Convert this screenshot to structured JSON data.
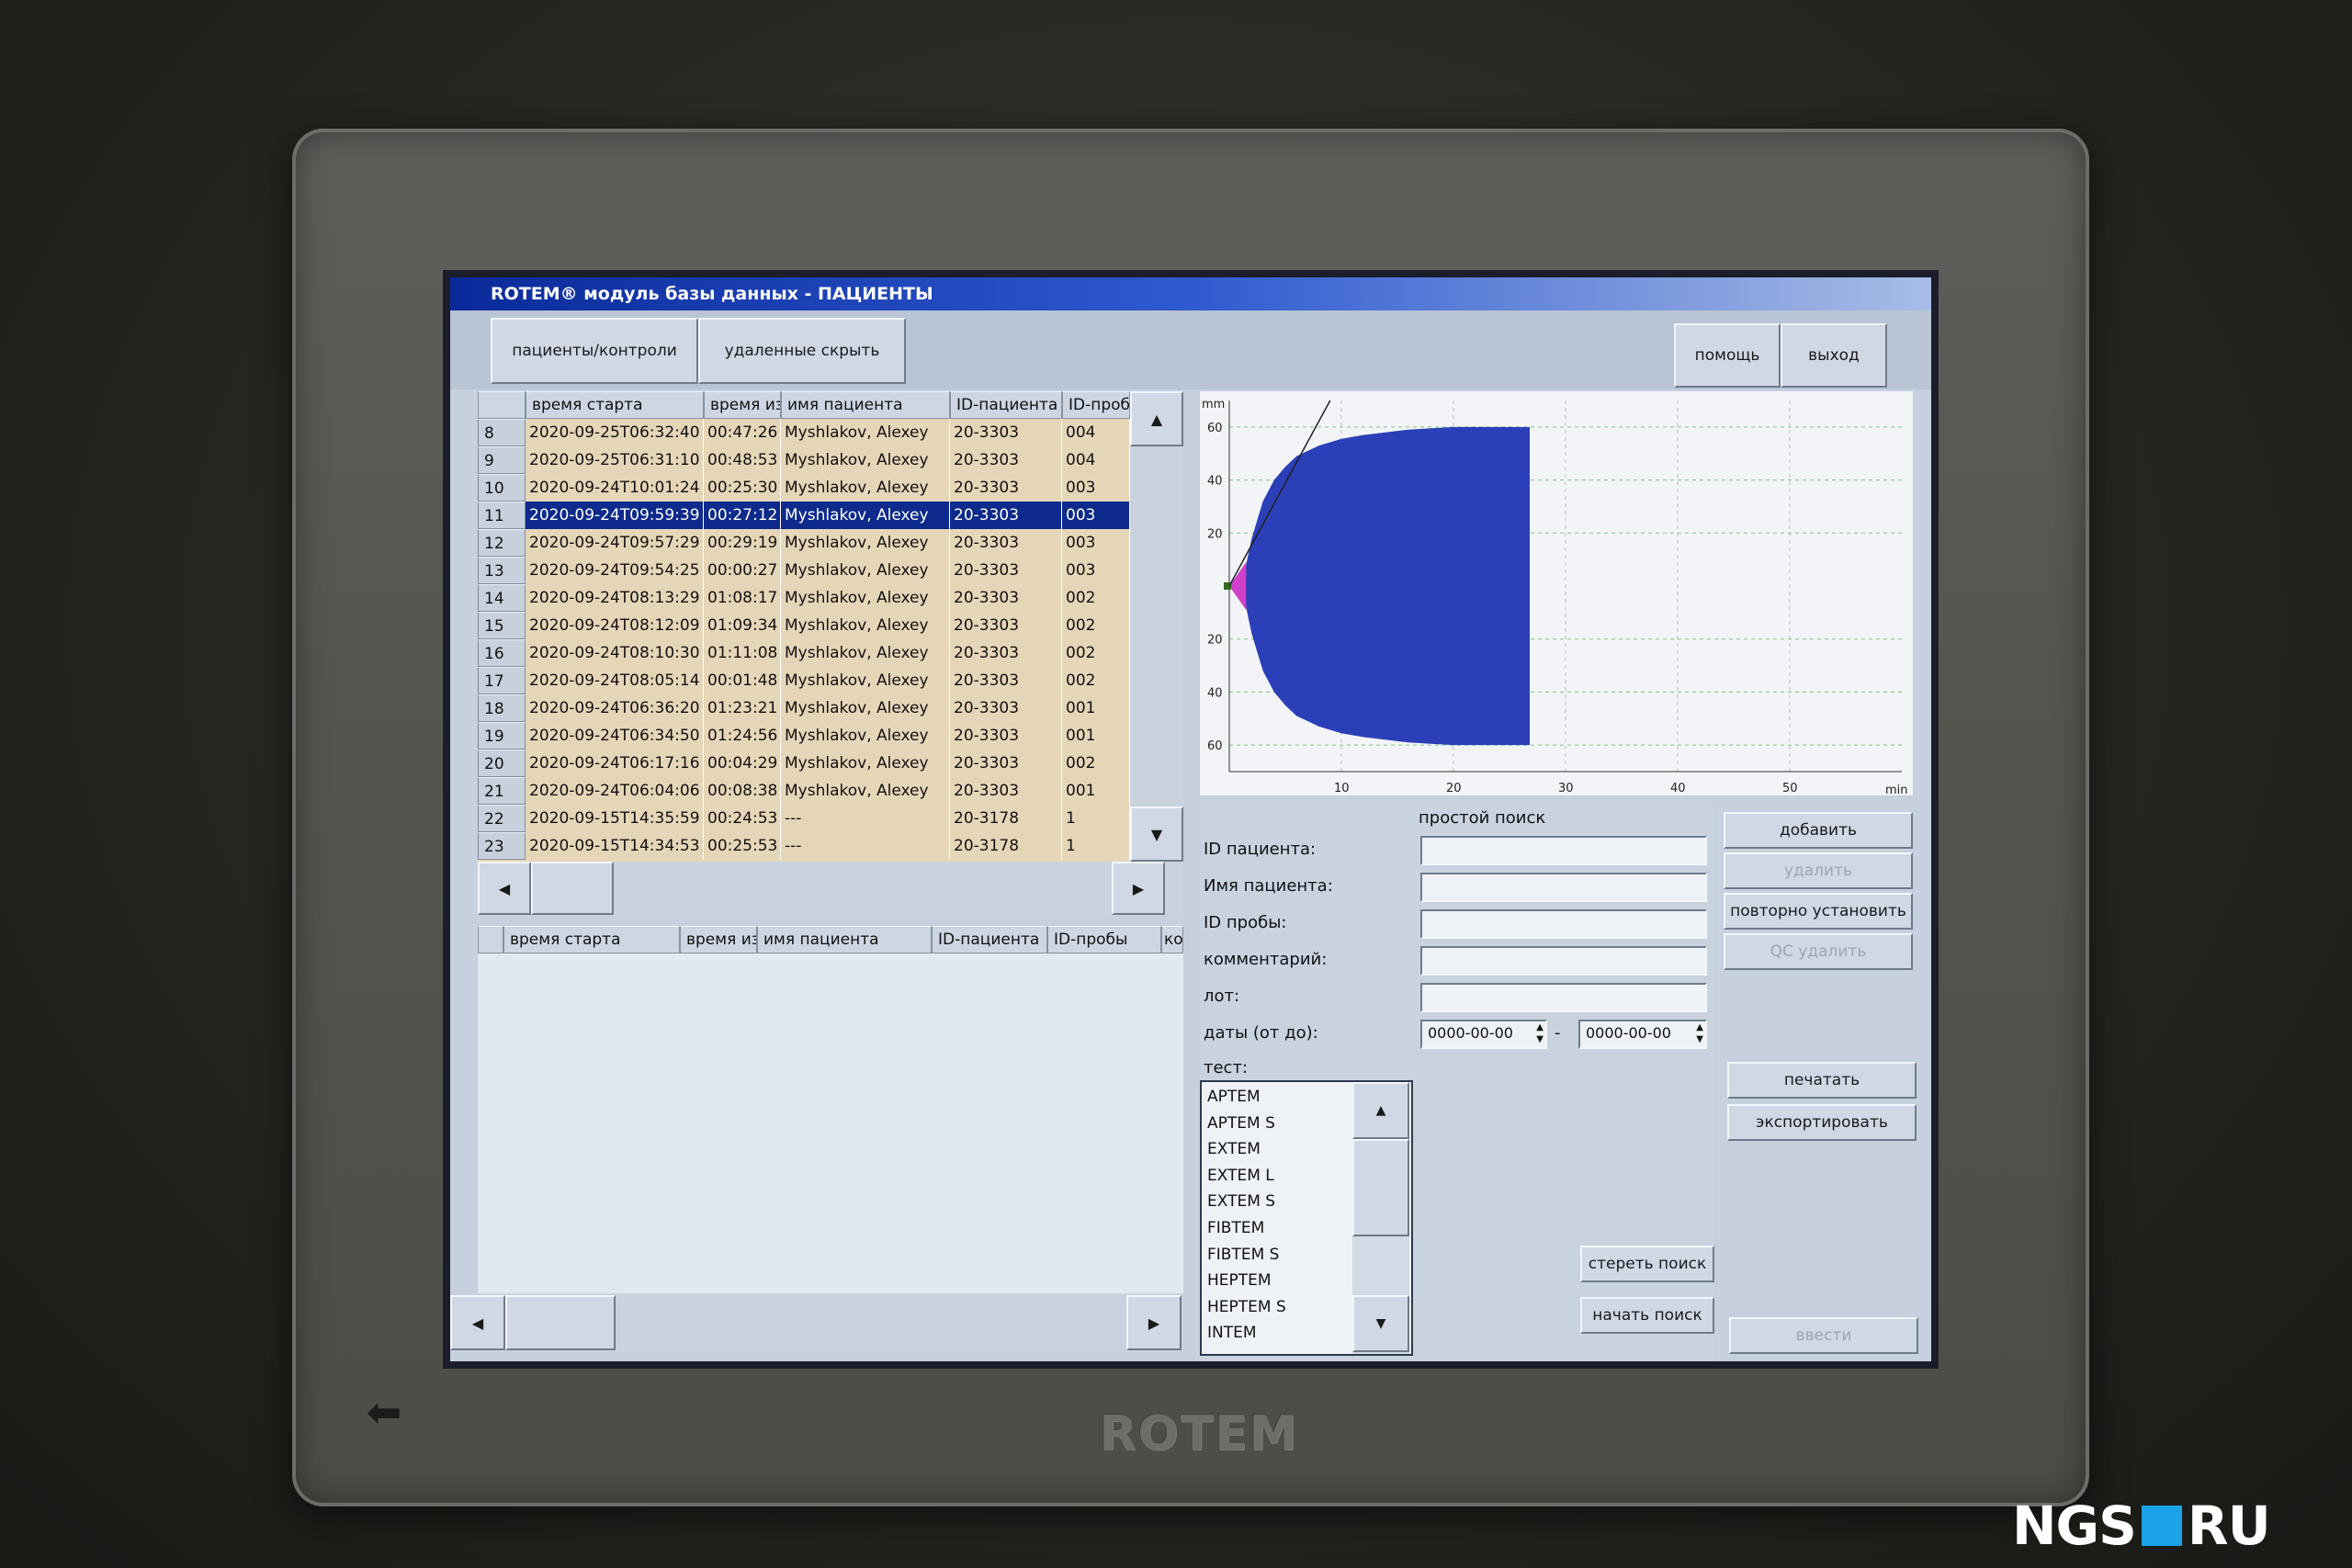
{
  "window": {
    "title": "ROTEM® модуль базы данных - ПАЦИЕНТЫ"
  },
  "toolbar": {
    "tab_patients": "пациенты/контроли",
    "tab_deleted": "удаленные скрыть",
    "help": "помощь",
    "exit": "выход"
  },
  "top_table": {
    "headers": [
      "время старта",
      "время из",
      "имя пациента",
      "ID-пациента",
      "ID-проб"
    ],
    "rows": [
      {
        "num": "8",
        "start": "2020-09-25T06:32:40",
        "time": "00:47:26",
        "name": "Myshlakov, Alexey",
        "pid": "20-3303",
        "sid": "004"
      },
      {
        "num": "9",
        "start": "2020-09-25T06:31:10",
        "time": "00:48:53",
        "name": "Myshlakov, Alexey",
        "pid": "20-3303",
        "sid": "004"
      },
      {
        "num": "10",
        "start": "2020-09-24T10:01:24",
        "time": "00:25:30",
        "name": "Myshlakov, Alexey",
        "pid": "20-3303",
        "sid": "003"
      },
      {
        "num": "11",
        "start": "2020-09-24T09:59:39",
        "time": "00:27:12",
        "name": "Myshlakov, Alexey",
        "pid": "20-3303",
        "sid": "003",
        "selected": true
      },
      {
        "num": "12",
        "start": "2020-09-24T09:57:29",
        "time": "00:29:19",
        "name": "Myshlakov, Alexey",
        "pid": "20-3303",
        "sid": "003"
      },
      {
        "num": "13",
        "start": "2020-09-24T09:54:25",
        "time": "00:00:27",
        "name": "Myshlakov, Alexey",
        "pid": "20-3303",
        "sid": "003"
      },
      {
        "num": "14",
        "start": "2020-09-24T08:13:29",
        "time": "01:08:17",
        "name": "Myshlakov, Alexey",
        "pid": "20-3303",
        "sid": "002"
      },
      {
        "num": "15",
        "start": "2020-09-24T08:12:09",
        "time": "01:09:34",
        "name": "Myshlakov, Alexey",
        "pid": "20-3303",
        "sid": "002"
      },
      {
        "num": "16",
        "start": "2020-09-24T08:10:30",
        "time": "01:11:08",
        "name": "Myshlakov, Alexey",
        "pid": "20-3303",
        "sid": "002"
      },
      {
        "num": "17",
        "start": "2020-09-24T08:05:14",
        "time": "00:01:48",
        "name": "Myshlakov, Alexey",
        "pid": "20-3303",
        "sid": "002"
      },
      {
        "num": "18",
        "start": "2020-09-24T06:36:20",
        "time": "01:23:21",
        "name": "Myshlakov, Alexey",
        "pid": "20-3303",
        "sid": "001"
      },
      {
        "num": "19",
        "start": "2020-09-24T06:34:50",
        "time": "01:24:56",
        "name": "Myshlakov, Alexey",
        "pid": "20-3303",
        "sid": "001"
      },
      {
        "num": "20",
        "start": "2020-09-24T06:17:16",
        "time": "00:04:29",
        "name": "Myshlakov, Alexey",
        "pid": "20-3303",
        "sid": "002"
      },
      {
        "num": "21",
        "start": "2020-09-24T06:04:06",
        "time": "00:08:38",
        "name": "Myshlakov, Alexey",
        "pid": "20-3303",
        "sid": "001"
      },
      {
        "num": "22",
        "start": "2020-09-15T14:35:59",
        "time": "00:24:53",
        "name": "---",
        "pid": "20-3178",
        "sid": "1"
      },
      {
        "num": "23",
        "start": "2020-09-15T14:34:53",
        "time": "00:25:53",
        "name": "---",
        "pid": "20-3178",
        "sid": "1"
      }
    ]
  },
  "bottom_table": {
    "headers": [
      "время старта",
      "время из",
      "имя пациента",
      "ID-пациента",
      "ID-пробы",
      "ком"
    ]
  },
  "chart_data": {
    "type": "area",
    "title": "",
    "xlabel": "min",
    "ylabel": "mm",
    "x_ticks": [
      "10",
      "20",
      "30",
      "40",
      "50"
    ],
    "y_ticks_upper": [
      "60",
      "40",
      "20"
    ],
    "y_ticks_lower": [
      "20",
      "40",
      "60"
    ],
    "xlim": [
      0,
      60
    ],
    "ylim": [
      -70,
      70
    ],
    "grid": true,
    "series": [
      {
        "x": [
          0,
          1,
          1.5,
          2,
          3,
          4,
          5,
          6,
          8,
          10,
          12,
          14,
          16,
          18,
          20,
          22,
          24,
          26.8
        ],
        "amplitude": [
          0,
          2,
          8,
          18,
          32,
          40,
          45,
          49,
          53,
          55.5,
          57,
          58,
          59,
          59.5,
          60,
          60,
          60,
          60
        ],
        "color": "#2a3fb8"
      }
    ],
    "initial_segment": {
      "x": [
        0,
        1.5
      ],
      "color": "#d040c8"
    },
    "tangent_line": {
      "x": [
        0,
        9
      ],
      "y": [
        0,
        70
      ],
      "color": "#222222"
    }
  },
  "search": {
    "title": "простой поиск",
    "labels": {
      "patient_id": "ID пациента:",
      "patient_name": "Имя пациента:",
      "sample_id": "ID пробы:",
      "comment": "комментарий:",
      "lot": "лот:",
      "dates": "даты (от до):",
      "test": "тест:"
    },
    "date_from": "0000-00-00",
    "date_sep": "-",
    "date_to": "0000-00-00",
    "tests": [
      "APTEM",
      "APTEM S",
      "EXTEM",
      "EXTEM L",
      "EXTEM S",
      "FIBTEM",
      "FIBTEM S",
      "HEPTEM",
      "HEPTEM S",
      "INTEM"
    ],
    "clear_button": "стереть поиск",
    "start_button": "начать поиск"
  },
  "actions": {
    "add": "добавить",
    "delete": "удалить",
    "reinstall": "повторно установить",
    "qc_delete": "QC удалить",
    "print": "печатать",
    "export": "экспортировать",
    "enter": "ввести"
  },
  "bezel": {
    "logo": "ROTEM",
    "back_icon": "arrow-left-icon"
  },
  "watermark": {
    "left": "NGS",
    "right": "RU",
    "accent": "#1aa3e8"
  }
}
